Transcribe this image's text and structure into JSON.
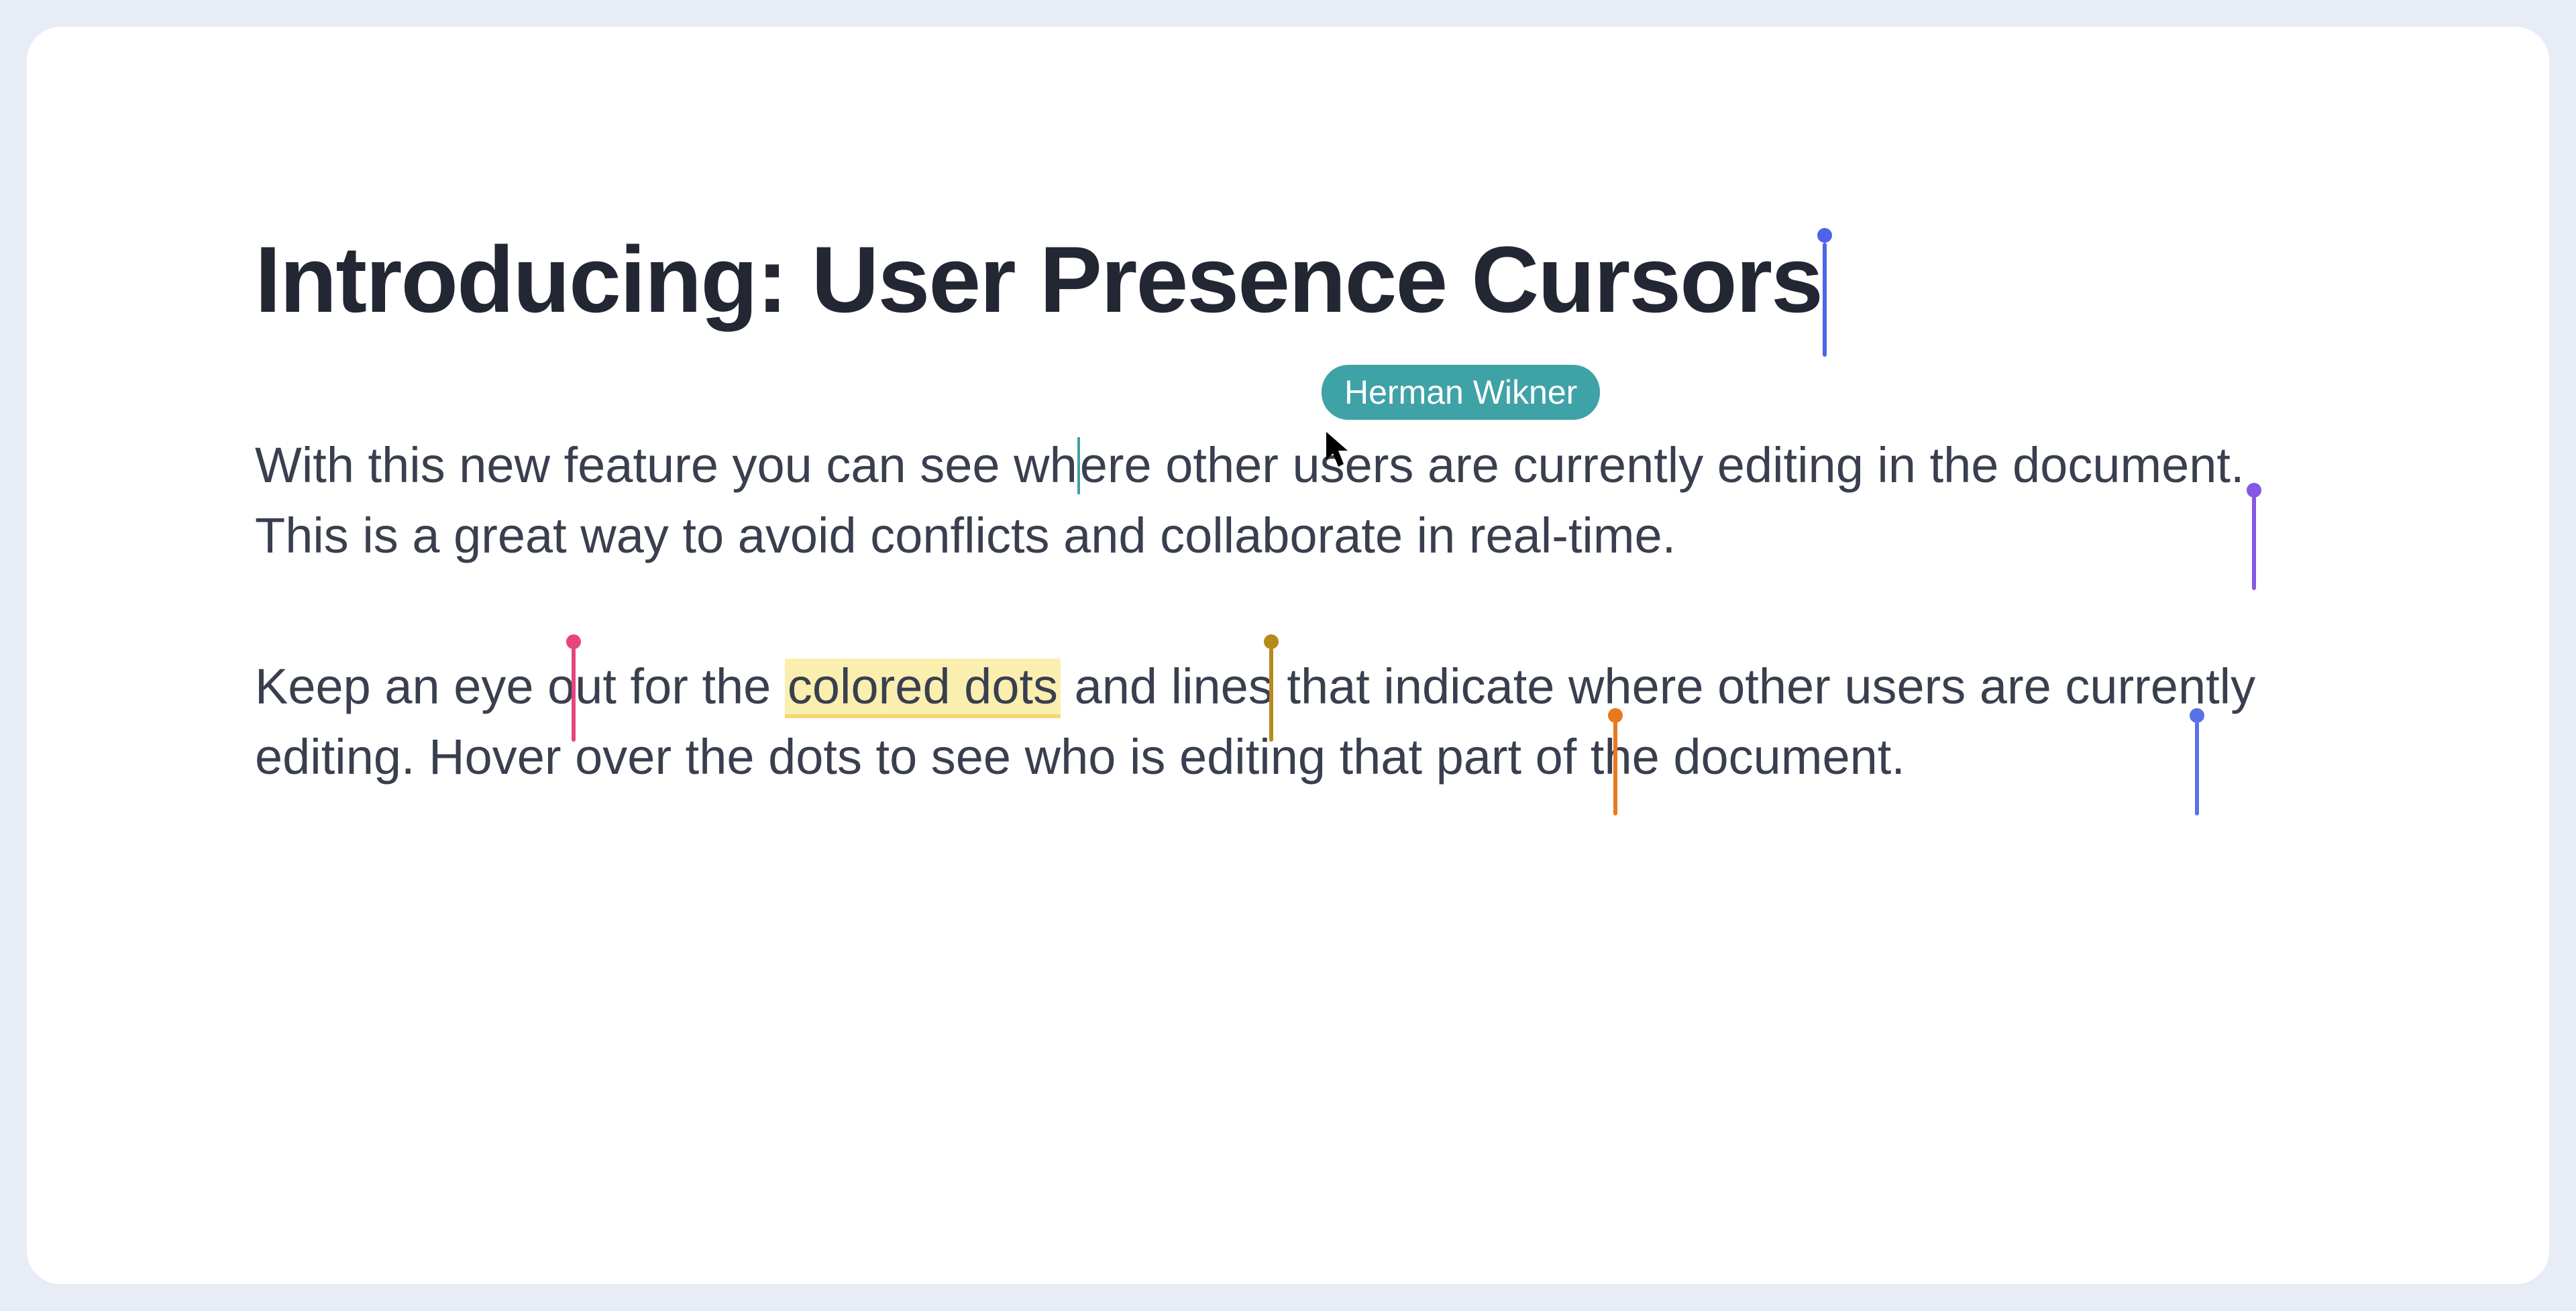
{
  "title": "Introducing: User Presence Cursors",
  "para1_a": "With this new feature you can see wh",
  "para1_b": "ere other users are currently editing in the document. This is a great way to avoid conflicts and collaborate in real-time.",
  "para2_a": "Keep an eye out for the ",
  "para2_hl": "colored dots",
  "para2_b": " and lines that indicate where other users are currently editing. Hover over the dots to see who is editing that part of the document.",
  "bubble_name": "Herman Wikner",
  "colors": {
    "blue": "#4e64e8",
    "purple": "#8457e6",
    "teal": "#3fa2a6",
    "pink": "#e6457f",
    "olive": "#b78a1e",
    "orange": "#e77a1e",
    "violetblue": "#5a72e6"
  }
}
